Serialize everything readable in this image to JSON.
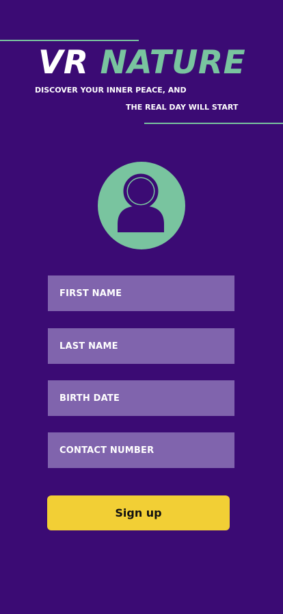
{
  "header": {
    "title_part1": "VR",
    "title_part2": "NATURE",
    "tagline_line1": "DISCOVER YOUR INNER PEACE, AND",
    "tagline_line2": "THE REAL DAY WILL START"
  },
  "avatar": {
    "icon": "user-icon"
  },
  "form": {
    "fields": [
      {
        "label": "FIRST NAME"
      },
      {
        "label": "LAST NAME"
      },
      {
        "label": "BIRTH DATE"
      },
      {
        "label": "CONTACT NUMBER"
      }
    ],
    "submit_label": "Sign up"
  },
  "colors": {
    "background": "#3b0b74",
    "accent_green": "#79c49f",
    "field_background": "#8064ad",
    "button_yellow": "#f2cf35"
  }
}
